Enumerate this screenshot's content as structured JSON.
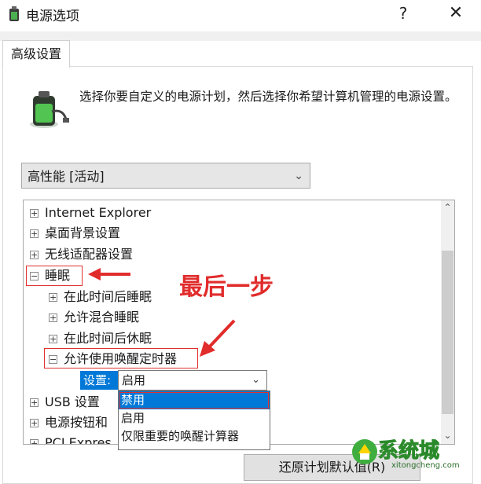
{
  "window": {
    "title": "电源选项",
    "help": "?",
    "close": "✕"
  },
  "tabs": [
    {
      "label": "高级设置"
    }
  ],
  "description": "选择你要自定义的电源计划，然后选择你希望计算机管理的电源设置。",
  "plan": {
    "selected": "高性能 [活动]"
  },
  "tree": {
    "items": [
      {
        "label": "Internet Explorer",
        "expander": "+"
      },
      {
        "label": "桌面背景设置",
        "expander": "+"
      },
      {
        "label": "无线适配器设置",
        "expander": "+"
      },
      {
        "label": "睡眠",
        "expander": "−"
      },
      {
        "label": "在此时间后睡眠",
        "expander": "+"
      },
      {
        "label": "允许混合睡眠",
        "expander": "+"
      },
      {
        "label": "在此时间后休眠",
        "expander": "+"
      },
      {
        "label": "允许使用唤醒定时器",
        "expander": "−"
      },
      {
        "label": "USB 设置",
        "expander": "+"
      },
      {
        "label": "电源按钮和",
        "expander": "+"
      },
      {
        "label": "PCI Expres",
        "expander": "+"
      }
    ]
  },
  "setting": {
    "label": "设置:",
    "value": "启用",
    "options": [
      "禁用",
      "启用",
      "仅限重要的唤醒计算器"
    ]
  },
  "annotation": "最后一步",
  "restore_button": "还原计划默认值(R)",
  "watermark": {
    "text": "系统城",
    "sub": "xitongcheng.com"
  },
  "colors": {
    "accent": "#0078d7",
    "annotation_red": "#e12c2c"
  }
}
